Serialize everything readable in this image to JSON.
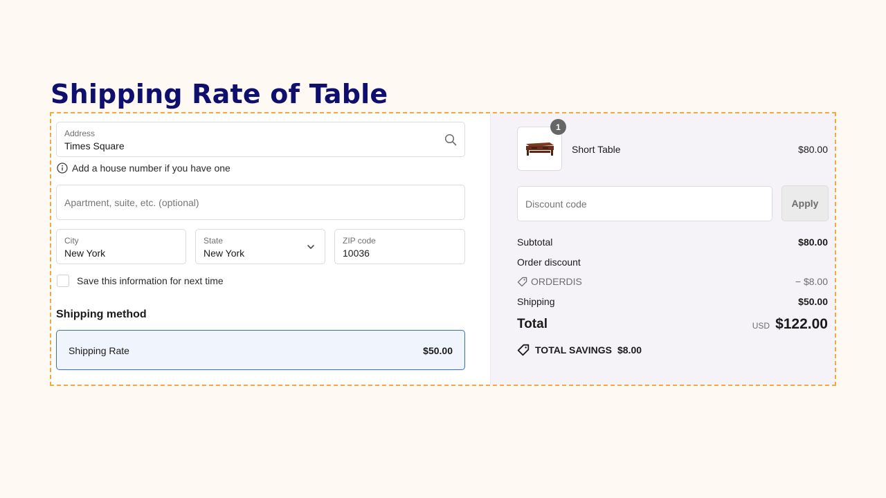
{
  "page": {
    "title": "Shipping Rate of Table"
  },
  "address": {
    "label": "Address",
    "value": "Times Square",
    "hint": "Add a house number if you have one",
    "apartment_placeholder": "Apartment, suite, etc. (optional)",
    "city_label": "City",
    "city_value": "New York",
    "state_label": "State",
    "state_value": "New York",
    "zip_label": "ZIP code",
    "zip_value": "10036",
    "save_label": "Save this information for next time"
  },
  "shipping": {
    "section_title": "Shipping method",
    "option_name": "Shipping Rate",
    "option_price": "$50.00"
  },
  "summary": {
    "item": {
      "quantity": "1",
      "name": "Short Table",
      "price": "$80.00"
    },
    "discount_placeholder": "Discount code",
    "apply_label": "Apply",
    "subtotal_label": "Subtotal",
    "subtotal_value": "$80.00",
    "order_discount_label": "Order discount",
    "discount_code": "ORDERDIS",
    "discount_value": "− $8.00",
    "shipping_label": "Shipping",
    "shipping_value": "$50.00",
    "total_label": "Total",
    "currency": "USD",
    "total_value": "$122.00",
    "savings_label": "TOTAL SAVINGS",
    "savings_value": "$8.00"
  },
  "icons": {
    "address_search": "search-icon",
    "hint": "info-icon",
    "state_select": "chevron-down-icon",
    "discount_tag": "tag-icon",
    "savings": "tag-icon"
  },
  "colors": {
    "title": "#0f0f6e",
    "frame_border": "#f4a940",
    "selected_option_bg": "#f0f4fd",
    "selected_option_border": "#2f6fd0",
    "summary_bg": "#f5f3f7"
  }
}
